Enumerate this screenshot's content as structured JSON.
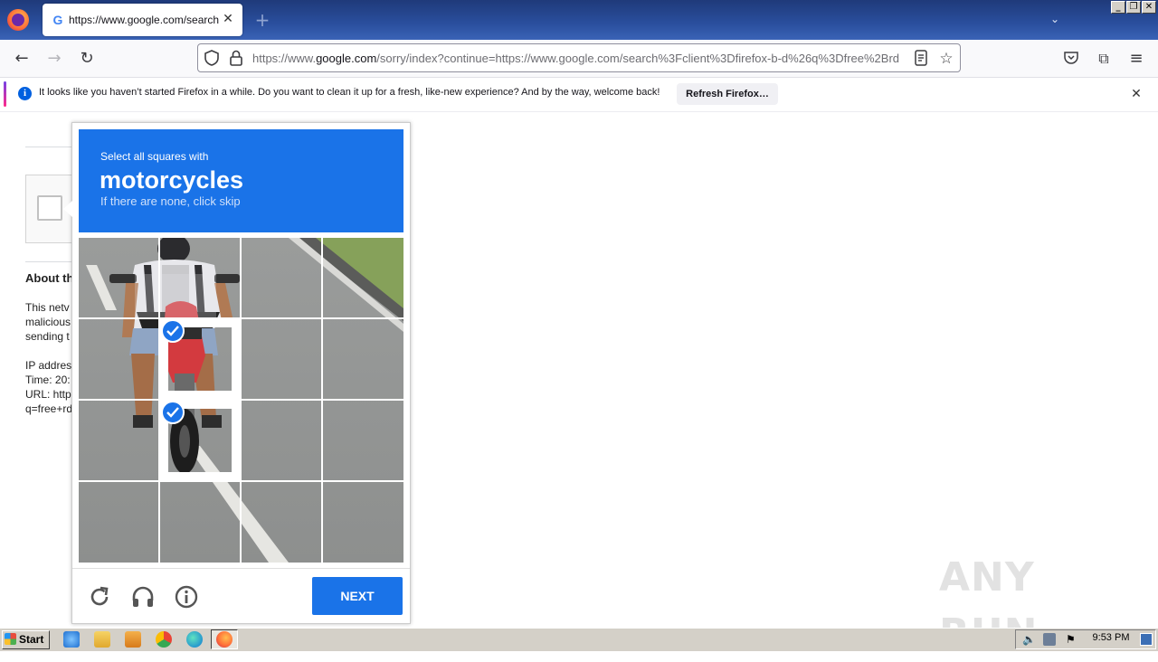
{
  "browser": {
    "tab": {
      "title": "https://www.google.com/search?client=firefox-b-d&q=free+rdp"
    },
    "url": {
      "prefix": "https://www.",
      "domain": "google.com",
      "rest": "/sorry/index?continue=https://www.google.com/search%3Fclient%3Dfirefox-b-d%26q%3Dfree%2Brd"
    },
    "notification": {
      "message": "It looks like you haven’t started Firefox in a while. Do you want to clean it up for a fresh, like-new experience? And by the way, welcome back!",
      "button_label": "Refresh Firefox…"
    },
    "icons": [
      "firefox-menu-icon",
      "back-icon",
      "forward-icon",
      "reload-icon",
      "shield-icon",
      "lock-icon",
      "reader-view-icon",
      "bookmark-star-icon",
      "pocket-icon",
      "extensions-icon",
      "hamburger-menu-icon"
    ]
  },
  "page": {
    "heading": "About th",
    "paragraph_lines": [
      "This netv",
      "malicious",
      "sending t"
    ],
    "info_lines": [
      "IP addres",
      "Time: 20:",
      "URL: http",
      "q=free+rd"
    ]
  },
  "captcha": {
    "instruction": "Select all squares with",
    "target": "motorcycles",
    "subtext": "If there are none, click skip",
    "grid": {
      "rows": 4,
      "cols": 4,
      "selected": [
        [
          1,
          1
        ],
        [
          2,
          1
        ]
      ]
    },
    "next_label": "NEXT",
    "footer_icons": [
      "reload-icon",
      "headphones-icon",
      "info-icon"
    ],
    "colors": {
      "brand": "#1a73e8"
    }
  },
  "watermark": "ANY RUN",
  "taskbar": {
    "start_label": "Start",
    "clock": "9:53 PM",
    "apps": [
      "ie-icon",
      "explorer-icon",
      "media-player-icon",
      "chrome-icon",
      "edge-icon",
      "firefox-icon"
    ]
  }
}
